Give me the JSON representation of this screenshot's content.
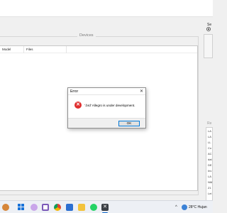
{
  "devices": {
    "group_title": "Devices",
    "columns": [
      "Model",
      "Files"
    ]
  },
  "right_panel": {
    "select_label": "Se",
    "recent_label": "Re",
    "recent_items": [
      "LA",
      "LA",
      "LL",
      "Co",
      "AC",
      "dat",
      "DE",
      "Inv",
      "LA",
      "NM",
      "Z1",
      "Lei"
    ]
  },
  "error_dialog": {
    "title": "Error",
    "close_glyph": "✕",
    "icon_glyph": "✕",
    "message": "'.brd' Allegro is under development.",
    "ok_label": "OK"
  },
  "taskbar": {
    "active_app_glyph": "✕",
    "tray_chevron": "^",
    "weather_text": "28°C Hujan"
  }
}
